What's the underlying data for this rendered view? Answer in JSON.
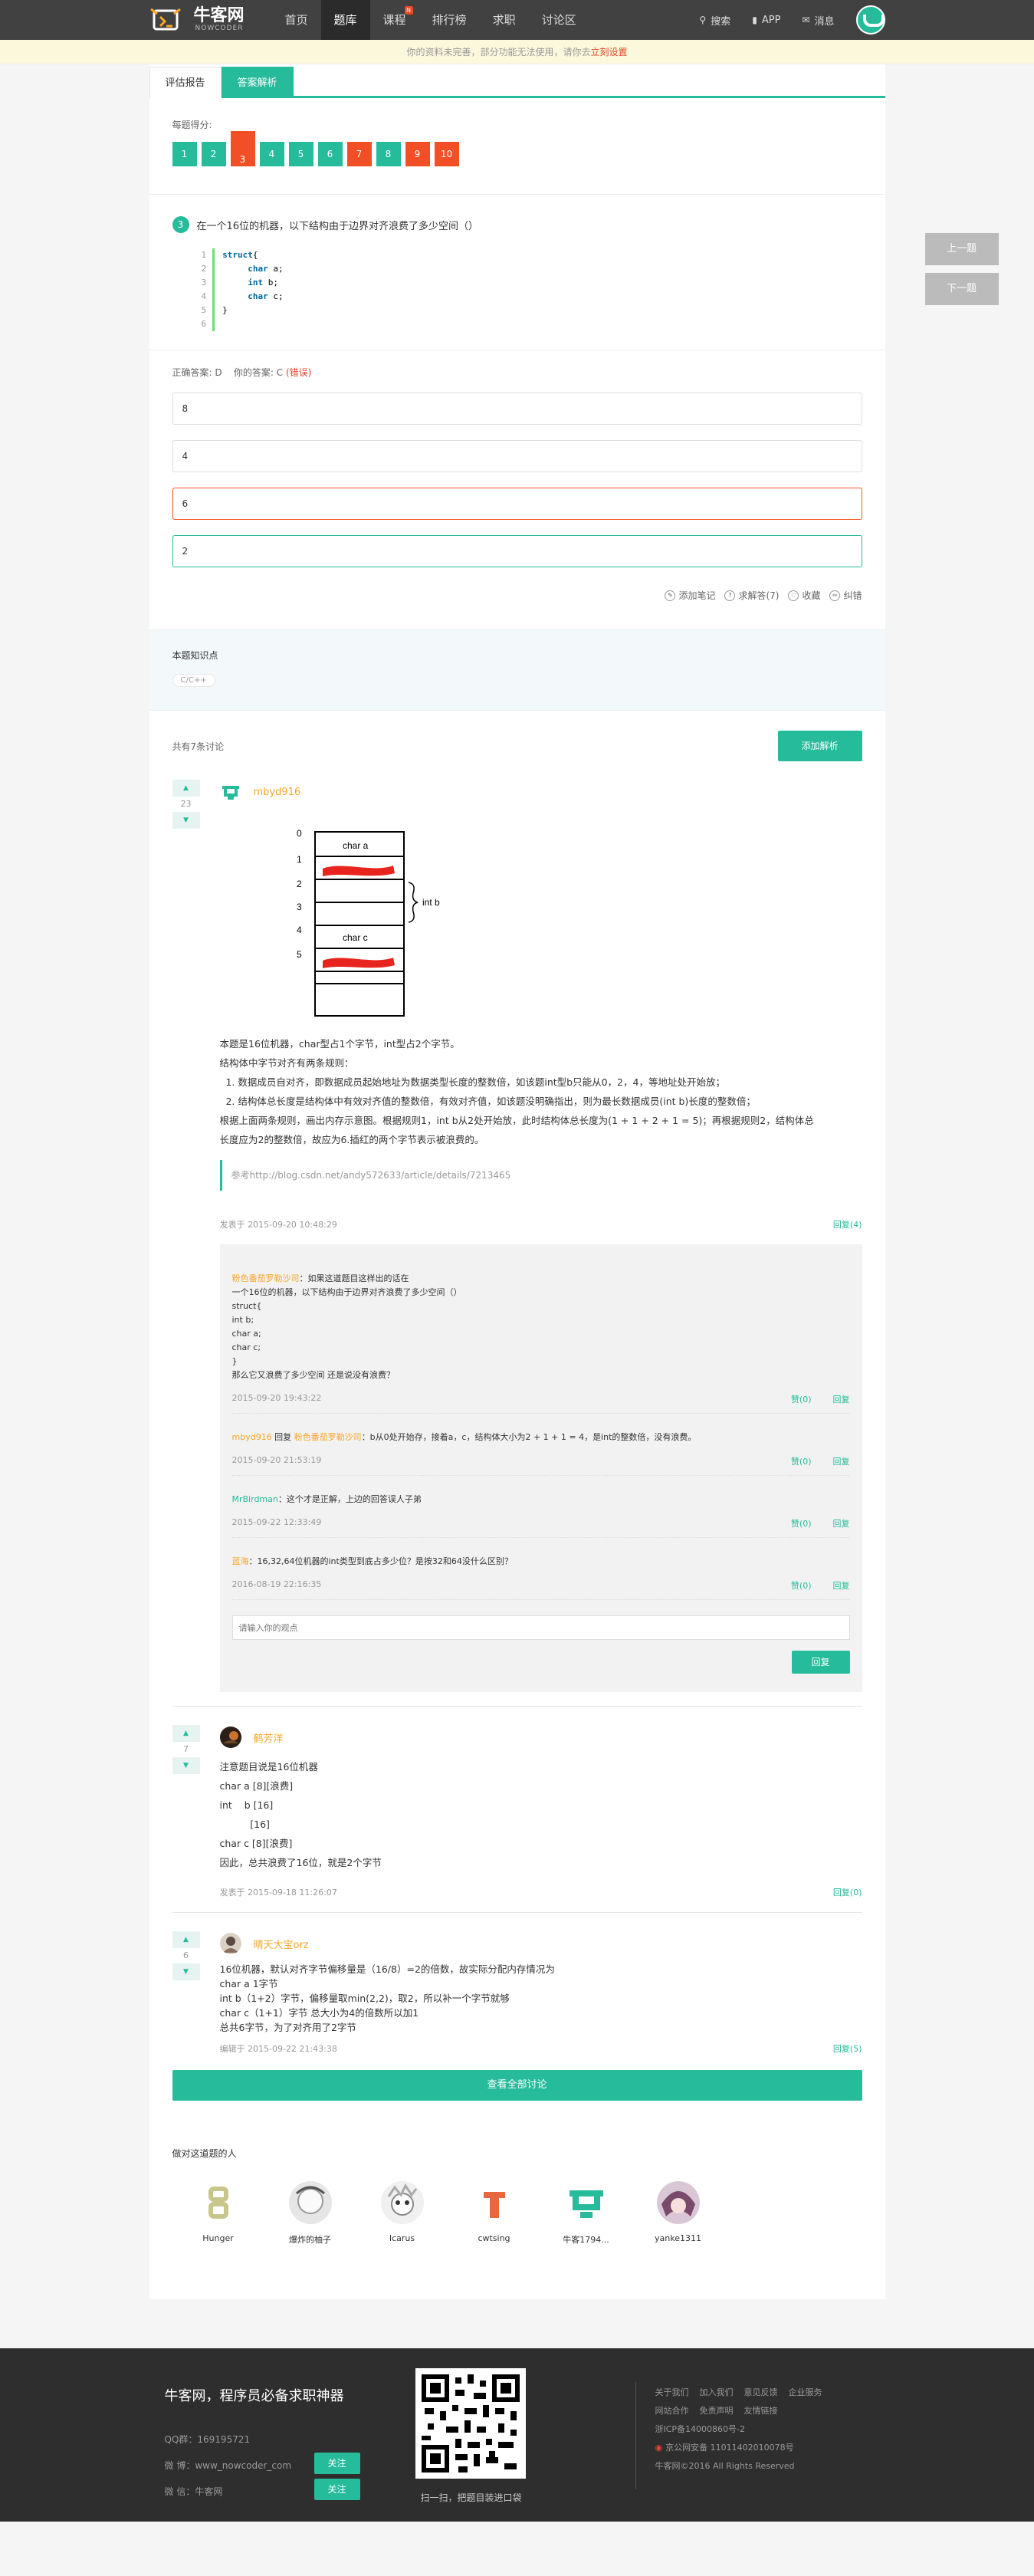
{
  "header": {
    "logo_cn": "牛客网",
    "logo_en": "NOWCODER",
    "nav": [
      "首页",
      "题库",
      "课程",
      "排行榜",
      "求职",
      "讨论区"
    ],
    "active_nav": "题库",
    "course_badge": "N",
    "search": "搜索",
    "app": "APP",
    "messages": "消息"
  },
  "notice": {
    "text": "你的资料未完善，部分功能无法使用，请你去",
    "link": "立刻设置"
  },
  "tabs": [
    "评估报告",
    "答案解析"
  ],
  "score": {
    "label": "每题得分:",
    "items": [
      {
        "n": "1",
        "status": "ok"
      },
      {
        "n": "2",
        "status": "ok"
      },
      {
        "n": "3",
        "status": "bad"
      },
      {
        "n": "4",
        "status": "ok"
      },
      {
        "n": "5",
        "status": "ok"
      },
      {
        "n": "6",
        "status": "ok"
      },
      {
        "n": "7",
        "status": "bad"
      },
      {
        "n": "8",
        "status": "ok"
      },
      {
        "n": "9",
        "status": "bad"
      },
      {
        "n": "10",
        "status": "bad"
      }
    ]
  },
  "side_buttons": {
    "prev": "上一题",
    "next": "下一题"
  },
  "question": {
    "number": "3",
    "text": "在一个16位的机器，以下结构由于边界对齐浪费了多少空间（）",
    "code_line_numbers": [
      "1",
      "2",
      "3",
      "4",
      "5",
      "6"
    ],
    "code_lines": [
      "struct{",
      "     char a;",
      "     int b;",
      "     char c;",
      "}",
      ""
    ]
  },
  "answer": {
    "correct_label": "正确答案: D",
    "yours_label": "你的答案: C",
    "wrong_tag": "(错误)",
    "options": [
      "8",
      "4",
      "6",
      "2"
    ]
  },
  "actions": [
    "添加笔记",
    "求解答(7)",
    "收藏",
    "纠错"
  ],
  "knowledge": {
    "title": "本题知识点",
    "tag": "C/C++"
  },
  "discuss": {
    "count": "共有7条讨论",
    "add_button": "添加解析",
    "view_all": "查看全部讨论"
  },
  "post1": {
    "votes": "23",
    "user": "mbyd916",
    "diagram": {
      "row_labels": [
        "0",
        "1",
        "2",
        "3",
        "4",
        "5"
      ],
      "cell_a": "char a",
      "cell_c": "char c",
      "brace_label": "int b"
    },
    "text": "本题是16位机器，char型占1个字节，int型占2个字节。\n结构体中字节对齐有两条规则：\n  1. 数据成员自对齐，即数据成员起始地址为数据类型长度的整数倍，如该题int型b只能从0，2，4，等地址处开始放；\n  2. 结构体总长度是结构体中有效对齐值的整数倍，有效对齐值，如该题没明确指出，则为最长数据成员(int b)长度的整数倍；\n根据上面两条规则，画出内存示意图。根据规则1，int b从2处开始放，此时结构体总长度为(1 + 1 + 2 + 1 = 5)；再根据规则2，结构体总\n长度应为2的整数倍，故应为6.插红的两个字节表示被浪费的。",
    "quote": "参考http://blog.csdn.net/andy572633/article/details/7213465",
    "time": "发表于 2015-09-20 10:48:29",
    "reply": "回复(4)",
    "comments": [
      {
        "name": "粉色番茄罗勒沙司",
        "body": "：如果这道题目这样出的话在\n一个16位的机器，以下结构由于边界对齐浪费了多少空间（）\nstruct{\nint b;\nchar a;\nchar c;\n}\n那么它又浪费了多少空间 还是说没有浪费？",
        "time": "2015-09-20 19:43:22",
        "likes": "赞(0)",
        "reply": "回复"
      },
      {
        "name": "mbyd916",
        "mid": " 回复 ",
        "name2": "粉色番茄罗勒沙司",
        "body": "：b从0处开始存，接着a，c，结构体大小为2 + 1 + 1 = 4，是int的整数倍，没有浪费。",
        "time": "2015-09-20 21:53:19",
        "likes": "赞(0)",
        "reply": "回复"
      },
      {
        "name": "MrBirdman",
        "body": "：这个才是正解，上边的回答误人子弟",
        "time": "2015-09-22 12:33:49",
        "likes": "赞(0)",
        "reply": "回复"
      },
      {
        "name": "蓝海",
        "body": "：16,32,64位机器的int类型到底占多少位？是按32和64没什么区别？",
        "time": "2016-08-19 22:16:35",
        "likes": "赞(0)",
        "reply": "回复"
      }
    ],
    "reply_placeholder": "请输入你的观点",
    "reply_button": "回复"
  },
  "post2": {
    "votes": "7",
    "user": "鹤芳洋",
    "text": "注意题目说是16位机器\nchar a [8][浪费]\nint    b [16]\n          [16]\nchar c [8][浪费]\n因此，总共浪费了16位，就是2个字节",
    "time": "发表于 2015-09-18 11:26:07",
    "reply": "回复(0)"
  },
  "post3": {
    "votes": "6",
    "user": "晴天大宝orz",
    "text": "16位机器，默认对齐字节偏移量是（16/8）=2的倍数，故实际分配内存情况为\nchar a 1字节\nint b（1+2）字节，偏移量取min(2,2)，取2，所以补一个字节就够\nchar c（1+1）字节 总大小为4的倍数所以加1\n总共6字节，为了对齐用了2字节",
    "time": "编辑于 2015-09-22 21:43:38",
    "reply": "回复(5)"
  },
  "people": {
    "title": "做对这道题的人",
    "list": [
      "Hunger",
      "爆炸的柚子",
      "Icarus",
      "cwtsing",
      "牛客1794...",
      "yanke1311"
    ]
  },
  "footer": {
    "title": "牛客网，程序员必备求职神器",
    "qq": "QQ群：169195721",
    "weibo": "微 博：www_nowcoder_com",
    "weixin": "微 信：牛客网",
    "follow": "关注",
    "qr_caption": "扫一扫，把题目装进口袋",
    "links": [
      "关于我们",
      "加入我们",
      "意见反馈",
      "企业服务",
      "网站合作",
      "免责声明",
      "友情链接"
    ],
    "icp": "浙ICP备14000860号-2",
    "police": "京公网安备 11011402010078号",
    "copyright": "牛客网©2016 All Rights Reserved"
  },
  "colors": {
    "accent": "#25bb9b",
    "wrong": "#f34f26",
    "username": "#f9a526",
    "footer_bg": "#2e2e2e",
    "topbar": "#414141"
  }
}
